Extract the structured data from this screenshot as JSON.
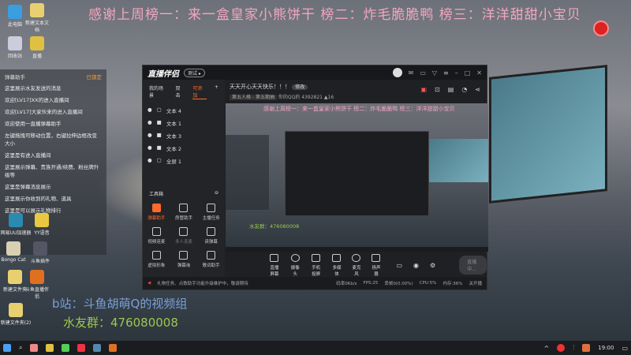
{
  "banner": "感谢上周榜一：来一盒皇家小熊饼干 榜二：炸毛脆脆鸭 榜三：洋洋甜甜小宝贝",
  "desktop_icons": [
    "此电脑",
    "新建文本文档",
    "回收站",
    "直播",
    "新建文件夹",
    "斗鱼直播伴侣",
    "新建文件夹(2)",
    "网易UU加速器",
    "YY语音",
    "Bongo Cat",
    "斗鱼插件"
  ],
  "chat": {
    "title": "弹幕助手",
    "lock": "已锁定",
    "lines": [
      "这里展示水友发送的消息",
      "欢迎[LV17]XX的进入直播间",
      "欢迎[LV17]大家伙来的进入直播间",
      "欢迎使用一直播弹幕助手",
      "左键拖拽可移动位置，右键拉伸边框改变大小",
      "这里是有进入直播间",
      "这里展示弹幕、贵族开通/续费、粉丝牌升级等",
      "这里是弹幕消息展示",
      "这里展示你收到的礼物、道具",
      "这里是可以展示礼物排行"
    ]
  },
  "overlay": {
    "bili": "b站：斗鱼胡萌Q的视频组",
    "qq": "水友群：476080008"
  },
  "app": {
    "logo": "直播伴侣",
    "version": "测试 ▸",
    "tabs": [
      "我的场景",
      "双击",
      "可添加"
    ],
    "sources": [
      "文本 4",
      "文本 1",
      "文本 3",
      "文本 2",
      "全屏 1"
    ],
    "stream_title": "天天开心天天快乐！！！",
    "edit": "修改",
    "category": "第五人格 - 第五期抽",
    "room": "你的QQ的 4392821",
    "fans": "16",
    "tools_title": "工具箱",
    "tools": [
      "弹幕助手",
      "房管助手",
      "主播任务",
      "视频连麦",
      "多人连麦",
      "读弹幕",
      "虚拟形象",
      "弹幕询",
      "歌词助手"
    ],
    "controls": [
      "直播屏幕",
      "摄像头",
      "手机投屏",
      "多媒体",
      "麦克风",
      "扬声器"
    ],
    "live_button": "直播中...",
    "notice": "礼物任务、点歌助手功能升级维护中，敬请期待",
    "stats": [
      "码率0Kb/s",
      "FPS:25",
      "丢帧0(0.00%)",
      "CPU:5%",
      "内存:36%",
      "关开播"
    ]
  },
  "taskbar": {
    "time": "19:00"
  }
}
